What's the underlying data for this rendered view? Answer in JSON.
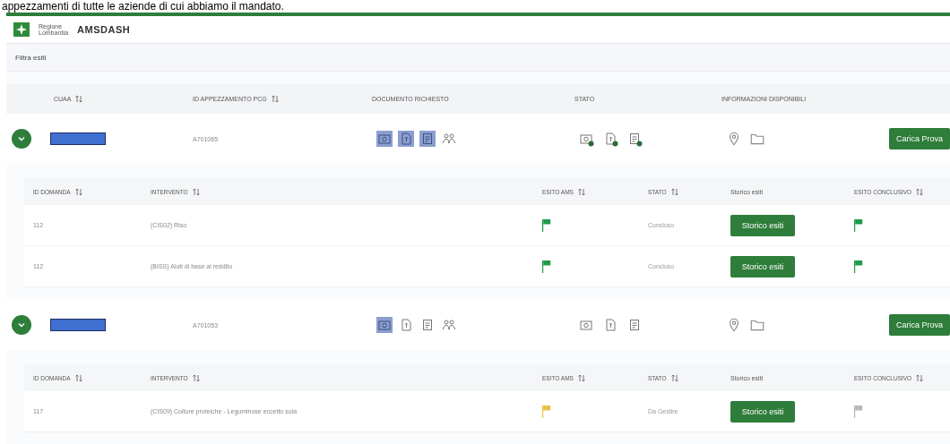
{
  "caption": "appezzamenti di tutte le aziende di cui abbiamo il mandato.",
  "header": {
    "logo_text": [
      "Regione",
      "Lombardia"
    ],
    "app_name": "AMSDASH"
  },
  "filter": {
    "label": "Filtra esiti"
  },
  "columns": [
    {
      "label": "CUAA",
      "sortable": true
    },
    {
      "label": "ID APPEZZAMENTO PCG",
      "sortable": true
    },
    {
      "label": "DOCUMENTO RICHIESTO",
      "sortable": false
    },
    {
      "label": "STATO",
      "sortable": false
    },
    {
      "label": "INFORMAZIONI DISPONIBILI",
      "sortable": false
    }
  ],
  "rows": [
    {
      "expanded": true,
      "id": "A701065",
      "documents": [
        {
          "kind": "photo",
          "highlighted": true
        },
        {
          "kind": "file",
          "highlighted": true
        },
        {
          "kind": "report",
          "highlighted": true
        },
        {
          "kind": "people",
          "highlighted": false
        }
      ],
      "status": [
        {
          "kind": "photo",
          "checked": true
        },
        {
          "kind": "file",
          "checked": true
        },
        {
          "kind": "report",
          "checked": true
        }
      ],
      "info": [
        {
          "kind": "pin"
        },
        {
          "kind": "folder"
        }
      ],
      "button": "Carica Prova",
      "sub_columns": [
        {
          "label": "ID DOMANDA",
          "sortable": true
        },
        {
          "label": "INTERVENTO",
          "sortable": true
        },
        {
          "label": "ESITO AMS",
          "sortable": true
        },
        {
          "label": "STATO",
          "sortable": true
        },
        {
          "label": "Storico esiti",
          "sortable": false
        },
        {
          "label": "ESITO CONCLUSIVO",
          "sortable": true
        }
      ],
      "sub_rows": [
        {
          "id": "112",
          "intervento": "(CIS02) Riso",
          "esito_ams": {
            "color": "#1f9a4a"
          },
          "stato": "Concluso",
          "button": "Storico esiti",
          "esito_conclusivo": {
            "color": "#1f9a4a"
          }
        },
        {
          "id": "112",
          "intervento": "(BISS) Aiuti di base al reddito",
          "esito_ams": {
            "color": "#1f9a4a"
          },
          "stato": "Concluso",
          "button": "Storico esiti",
          "esito_conclusivo": {
            "color": "#1f9a4a"
          }
        }
      ]
    },
    {
      "expanded": true,
      "id": "A701053",
      "documents": [
        {
          "kind": "photo",
          "highlighted": true
        },
        {
          "kind": "file",
          "highlighted": false
        },
        {
          "kind": "report",
          "highlighted": false
        },
        {
          "kind": "people",
          "highlighted": false
        }
      ],
      "status": [
        {
          "kind": "photo",
          "checked": false
        },
        {
          "kind": "file",
          "checked": false
        },
        {
          "kind": "report",
          "checked": false
        }
      ],
      "info": [
        {
          "kind": "pin"
        },
        {
          "kind": "folder"
        }
      ],
      "button": "Carica Prova",
      "sub_columns": [
        {
          "label": "ID DOMANDA",
          "sortable": true
        },
        {
          "label": "INTERVENTO",
          "sortable": true
        },
        {
          "label": "ESITO AMS",
          "sortable": true
        },
        {
          "label": "STATO",
          "sortable": true
        },
        {
          "label": "Storico esiti",
          "sortable": false
        },
        {
          "label": "ESITO CONCLUSIVO",
          "sortable": true
        }
      ],
      "sub_rows": [
        {
          "id": "117",
          "intervento": "(CIS09) Colture proteiche - Leguminose eccetto soia",
          "esito_ams": {
            "color": "#e8c14a"
          },
          "stato": "Da Gestire",
          "button": "Storico esiti",
          "esito_conclusivo": {
            "color": "#b8b8b8"
          }
        }
      ]
    }
  ]
}
